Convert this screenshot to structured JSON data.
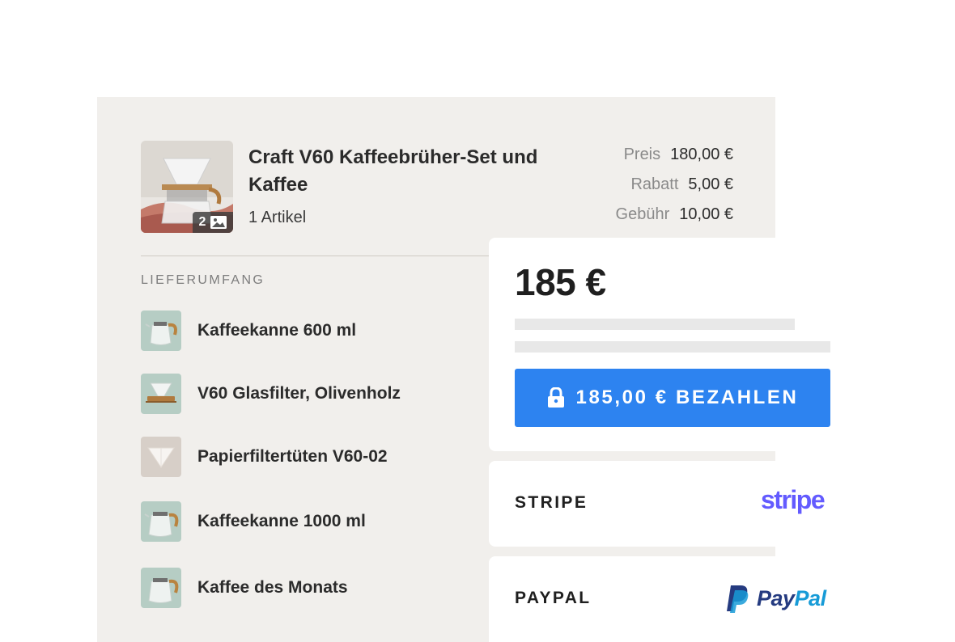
{
  "order": {
    "product_title": "Craft V60 Kaffeebrüher-Set und Kaffee",
    "item_count": "1 Artikel",
    "thumbnail_badge_count": "2",
    "prices": [
      {
        "label": "Preis",
        "value": "180,00 €"
      },
      {
        "label": "Rabatt",
        "value": "5,00 €"
      },
      {
        "label": "Gebühr",
        "value": "10,00 €"
      }
    ]
  },
  "contents": {
    "heading": "LIEFERUMFANG",
    "items": [
      {
        "label": "Kaffeekanne 600 ml",
        "icon": "coffee-pot-icon"
      },
      {
        "label": "V60 Glasfilter, Olivenholz",
        "icon": "glass-dripper-icon"
      },
      {
        "label": "Papierfiltertüten V60-02",
        "icon": "paper-filter-icon"
      },
      {
        "label": "Kaffeekanne 1000 ml",
        "icon": "coffee-pot-icon"
      },
      {
        "label": "Kaffee des Monats",
        "icon": "coffee-pot-icon"
      }
    ]
  },
  "payment": {
    "total": "185 €",
    "pay_button_label": "185,00 € BEZAHLEN",
    "pay_button_icon": "lock-icon",
    "methods": [
      {
        "label": "STRIPE",
        "logo": "stripe"
      },
      {
        "label": "PAYPAL",
        "logo": "PayPal"
      }
    ]
  },
  "colors": {
    "panel_background": "#f1efec",
    "item_icon_background": "#b6cdc4",
    "pay_button": "#2d83f0",
    "stripe_brand": "#635bff",
    "paypal_dark": "#253b80",
    "paypal_light": "#179bd7"
  }
}
